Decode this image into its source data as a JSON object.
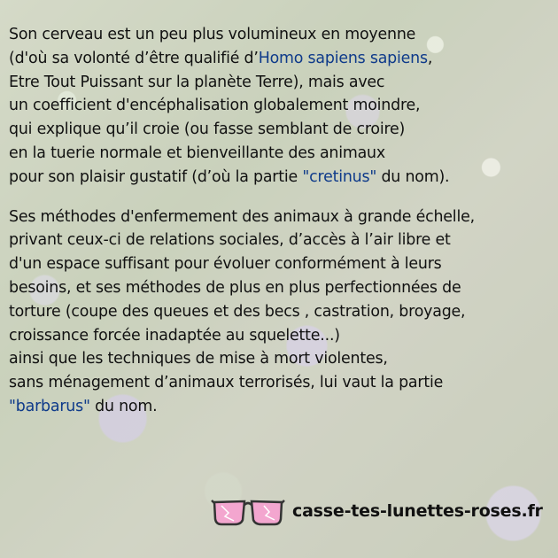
{
  "paragraph1": {
    "l1": "Son cerveau  est un peu plus volumineux en moyenne",
    "l2_pre": " (d'où sa volonté d’être qualifié d’",
    "l2_hl": "Homo sapiens sapiens",
    "l2_post": ",",
    "l3": " Etre Tout Puissant sur la planète Terre), mais avec",
    "l4": " un coefficient d'encéphalisation globalement moindre,",
    "l5": " qui explique qu’il croie (ou fasse semblant de croire)",
    "l6": " en la tuerie normale et bienveillante des animaux",
    "l7_pre": " pour son plaisir gustatif (d’où la partie ",
    "l7_hl": "\"cretinus\"",
    "l7_post": " du nom)."
  },
  "paragraph2": {
    "l1": "Ses méthodes d'enfermement des animaux à grande échelle,",
    "l2": " privant ceux-ci de relations sociales, d’accès à l’air libre et",
    "l3": "d'un espace suffisant pour évoluer conformément à leurs",
    "l4": "besoins, et ses méthodes de plus en plus perfectionnées de",
    "l5": "torture (coupe des queues et des becs , castration, broyage,",
    "l6": " croissance forcée inadaptée au squelette...)",
    "l7": " ainsi que les techniques de mise à mort violentes,",
    "l8": " sans ménagement d’animaux terrorisés, lui vaut la partie",
    "l9_hl": "\"barbarus\"",
    "l9_post": " du nom."
  },
  "footer": {
    "site": "casse-tes-lunettes-roses.fr",
    "icon": "broken-pink-glasses-icon"
  },
  "colors": {
    "highlight": "#0e3a8a",
    "text": "#111111",
    "glasses_lens": "#f3a6cf"
  }
}
